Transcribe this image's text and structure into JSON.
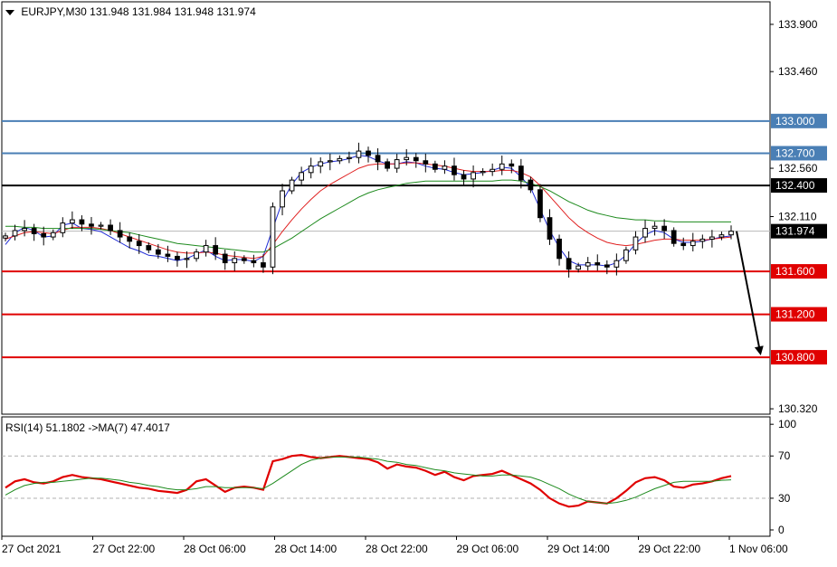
{
  "header": {
    "symbol": "EURJPY,M30",
    "open": "131.948",
    "high": "131.984",
    "low": "131.948",
    "close": "131.974"
  },
  "rsi_header": {
    "label": "RSI(14) 51.1802",
    "ma_label": "->MA(7) 47.4017"
  },
  "colors": {
    "background": "#ffffff",
    "grid_border": "#000000",
    "candle": "#000000",
    "ma_fast": "#1f2bd6",
    "ma_mid": "#e02020",
    "ma_slow": "#1d8a1d",
    "resistance": "#4a7fb5",
    "pivot": "#000000",
    "support": "#e00000",
    "current_price_line": "#b8b8b8",
    "rsi": "#e00000",
    "rsi_ma": "#1d8a1d",
    "arrow": "#000000"
  },
  "chart_data": [
    {
      "type": "candlestick",
      "symbol": "EURJPY",
      "timeframe": "M30",
      "y_axis": {
        "ticks": [
          "133.900",
          "133.460",
          "132.560",
          "132.110",
          "130.320"
        ],
        "ylim": [
          130.27,
          134.11
        ]
      },
      "x_axis": {
        "ticks": [
          "27 Oct 2021",
          "27 Oct 22:00",
          "28 Oct 06:00",
          "28 Oct 14:00",
          "28 Oct 22:00",
          "29 Oct 06:00",
          "29 Oct 14:00",
          "29 Oct 22:00",
          "1 Nov 06:00"
        ]
      },
      "levels": [
        {
          "label": "133.000",
          "value": 133.0,
          "kind": "resistance"
        },
        {
          "label": "132.700",
          "value": 132.7,
          "kind": "resistance"
        },
        {
          "label": "132.400",
          "value": 132.4,
          "kind": "pivot"
        },
        {
          "label": "131.600",
          "value": 131.6,
          "kind": "support"
        },
        {
          "label": "131.200",
          "value": 131.2,
          "kind": "support"
        },
        {
          "label": "130.800",
          "value": 130.8,
          "kind": "support"
        }
      ],
      "current_price": {
        "label": "131.974",
        "value": 131.974
      },
      "close_path": [
        131.93,
        131.98,
        132.0,
        131.95,
        131.92,
        131.96,
        132.05,
        132.08,
        132.04,
        132.02,
        132.03,
        131.98,
        131.92,
        131.88,
        131.84,
        131.8,
        131.76,
        131.74,
        131.71,
        131.72,
        131.78,
        131.84,
        131.76,
        131.68,
        131.72,
        131.7,
        131.68,
        131.64,
        132.2,
        132.35,
        132.45,
        132.52,
        132.58,
        132.62,
        132.63,
        132.65,
        132.66,
        132.72,
        132.68,
        132.62,
        132.56,
        132.64,
        132.66,
        132.63,
        132.6,
        132.55,
        132.58,
        132.5,
        132.46,
        132.52,
        132.53,
        132.55,
        132.6,
        132.58,
        132.45,
        132.36,
        132.1,
        131.9,
        131.72,
        131.62,
        131.65,
        131.68,
        131.66,
        131.64,
        131.7,
        131.8,
        131.92,
        132.0,
        132.02,
        131.98,
        131.86,
        131.84,
        131.88,
        131.9,
        131.92,
        131.94,
        131.974
      ],
      "moving_averages": [
        {
          "color": "ma_fast",
          "values": [
            131.85,
            131.96,
            132.01,
            131.98,
            131.92,
            131.93,
            132.03,
            132.05,
            132.0,
            131.99,
            131.97,
            131.92,
            131.87,
            131.82,
            131.79,
            131.75,
            131.74,
            131.72,
            131.7,
            131.72,
            131.76,
            131.8,
            131.74,
            131.7,
            131.71,
            131.71,
            131.69,
            131.74,
            132.0,
            132.25,
            132.41,
            132.52,
            132.57,
            132.6,
            132.62,
            132.63,
            132.65,
            132.68,
            132.67,
            132.63,
            132.6,
            132.6,
            132.62,
            132.61,
            132.58,
            132.56,
            132.55,
            132.52,
            132.5,
            132.51,
            132.52,
            132.54,
            132.57,
            132.56,
            132.48,
            132.38,
            132.18,
            131.98,
            131.82,
            131.7,
            131.66,
            131.66,
            131.66,
            131.65,
            131.68,
            131.75,
            131.86,
            131.94,
            131.98,
            131.96,
            131.9,
            131.87,
            131.87,
            131.88,
            131.9,
            131.92,
            131.93
          ]
        },
        {
          "color": "ma_mid",
          "values": [
            131.9,
            131.93,
            131.96,
            131.97,
            131.96,
            131.95,
            131.98,
            132.01,
            132.01,
            132.01,
            132.0,
            131.98,
            131.95,
            131.92,
            131.89,
            131.86,
            131.83,
            131.8,
            131.78,
            131.77,
            131.77,
            131.78,
            131.77,
            131.75,
            131.74,
            131.73,
            131.72,
            131.74,
            131.85,
            131.97,
            132.08,
            132.18,
            132.27,
            132.35,
            132.41,
            132.46,
            132.51,
            132.56,
            132.59,
            132.6,
            132.6,
            132.6,
            132.61,
            132.61,
            132.6,
            132.59,
            132.58,
            132.56,
            132.54,
            132.53,
            132.53,
            132.53,
            132.54,
            132.54,
            132.52,
            132.48,
            132.4,
            132.3,
            132.2,
            132.1,
            132.02,
            131.96,
            131.91,
            131.87,
            131.85,
            131.84,
            131.85,
            131.87,
            131.89,
            131.9,
            131.9,
            131.89,
            131.89,
            131.89,
            131.9,
            131.91,
            131.92
          ]
        },
        {
          "color": "ma_slow",
          "values": [
            132.02,
            132.02,
            132.01,
            132.01,
            132.0,
            132.0,
            132.0,
            132.0,
            132.0,
            132.0,
            131.99,
            131.98,
            131.97,
            131.96,
            131.94,
            131.92,
            131.9,
            131.88,
            131.86,
            131.85,
            131.84,
            131.83,
            131.82,
            131.81,
            131.8,
            131.79,
            131.78,
            131.78,
            131.81,
            131.86,
            131.91,
            131.97,
            132.03,
            132.09,
            132.14,
            132.19,
            132.24,
            132.29,
            132.33,
            132.36,
            132.38,
            132.4,
            132.42,
            132.43,
            132.44,
            132.44,
            132.44,
            132.44,
            132.44,
            132.44,
            132.44,
            132.44,
            132.45,
            132.45,
            132.44,
            132.42,
            132.39,
            132.35,
            132.3,
            132.25,
            132.21,
            132.17,
            132.14,
            132.12,
            132.1,
            132.09,
            132.08,
            132.08,
            132.07,
            132.07,
            132.06,
            132.06,
            132.06,
            132.06,
            132.06,
            132.06,
            132.06
          ]
        }
      ],
      "forecast_arrow": {
        "from": 131.974,
        "to": 130.8
      }
    },
    {
      "type": "line",
      "title": "RSI(14) 51.1802 ->MA(7) 47.4017",
      "y_axis": {
        "ticks": [
          "100",
          "70",
          "30",
          "0"
        ],
        "ylim": [
          -6,
          107
        ],
        "levels": [
          70,
          30
        ]
      },
      "series": [
        {
          "name": "RSI(14)",
          "color": "rsi",
          "values": [
            40,
            46,
            48,
            45,
            44,
            46,
            50,
            52,
            50,
            49,
            48,
            46,
            44,
            42,
            40,
            39,
            37,
            36,
            35,
            38,
            46,
            48,
            42,
            36,
            40,
            41,
            40,
            38,
            65,
            67,
            70,
            71,
            69,
            68,
            69,
            70,
            69,
            68,
            67,
            64,
            58,
            62,
            60,
            59,
            56,
            52,
            55,
            50,
            47,
            51,
            52,
            53,
            56,
            52,
            48,
            44,
            38,
            30,
            25,
            22,
            23,
            27,
            26,
            25,
            30,
            37,
            45,
            49,
            50,
            47,
            41,
            40,
            43,
            44,
            46,
            49,
            51
          ]
        },
        {
          "name": "MA(7)",
          "color": "rsi_ma",
          "values": [
            33,
            38,
            42,
            44,
            45,
            45,
            46,
            47,
            48,
            49,
            49,
            48,
            47,
            45,
            44,
            42,
            41,
            39,
            38,
            38,
            39,
            41,
            41,
            40,
            40,
            40,
            40,
            39,
            44,
            50,
            56,
            62,
            66,
            68,
            69,
            69,
            69,
            69,
            68,
            67,
            65,
            64,
            62,
            61,
            59,
            57,
            56,
            54,
            53,
            52,
            51,
            51,
            52,
            52,
            51,
            50,
            47,
            43,
            39,
            34,
            30,
            27,
            26,
            25,
            26,
            28,
            31,
            35,
            39,
            42,
            45,
            46,
            46,
            46,
            46,
            47,
            47.4
          ]
        }
      ]
    }
  ]
}
